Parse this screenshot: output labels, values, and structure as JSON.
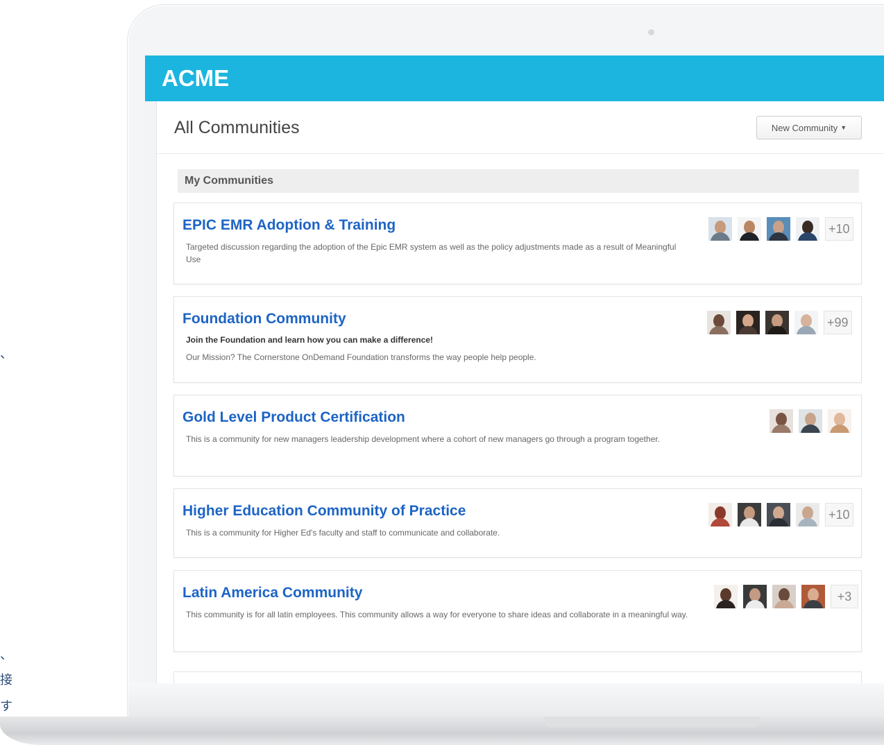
{
  "edge_text": [
    "、",
    "、",
    "接",
    "す"
  ],
  "header": {
    "logo": "ACME",
    "color": "#1cb5e0"
  },
  "page": {
    "title": "All Communities",
    "new_button": "New Community",
    "section_label": "My Communities"
  },
  "communities": [
    {
      "title": "EPIC EMR Adoption & Training",
      "tagline": "",
      "description": "Targeted discussion regarding the adoption of the Epic EMR system as well as the policy adjustments made as a result of Meaningful Use",
      "member_count": "+10"
    },
    {
      "title": "Foundation Community",
      "tagline": "Join the Foundation and learn how you can make a difference!",
      "description": "Our Mission? The Cornerstone OnDemand Foundation transforms the way people help people.",
      "member_count": "+99"
    },
    {
      "title": "Gold Level Product Certification",
      "tagline": "",
      "description": "This is a community for new managers leadership development where a cohort of new managers go through a program together.",
      "member_count": ""
    },
    {
      "title": "Higher Education Community of Practice",
      "tagline": "",
      "description": "This is a community for Higher Ed's faculty and staff to communicate and collaborate.",
      "member_count": "+10"
    },
    {
      "title": "Latin America Community",
      "tagline": "",
      "description": "This community is for all latin employees. This community allows a way for everyone to share ideas and collaborate in a meaningful way.",
      "member_count": "+3"
    }
  ]
}
